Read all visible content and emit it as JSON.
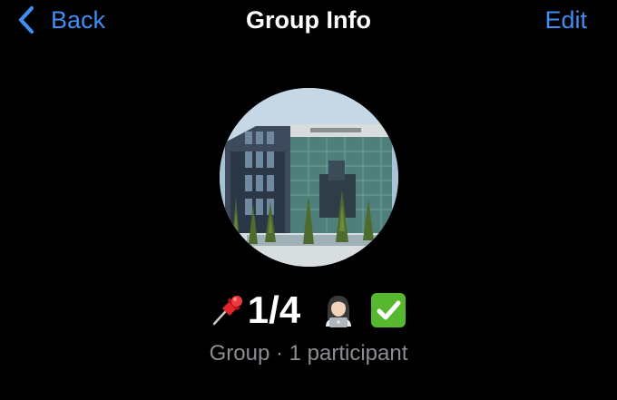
{
  "nav": {
    "back_label": "Back",
    "title": "Group Info",
    "edit_label": "Edit",
    "accent_color": "#3d8ef5"
  },
  "avatar": {
    "icon": "group-photo-building"
  },
  "group": {
    "name": "1/4",
    "name_prefix_icon": "pushpin-icon",
    "name_suffix_icons": [
      "technologist-icon",
      "check-mark-button-icon"
    ],
    "subtitle": "Group · 1 participant",
    "subtitle_color": "#8d8d93"
  },
  "colors": {
    "background": "#000000",
    "text": "#ffffff"
  }
}
